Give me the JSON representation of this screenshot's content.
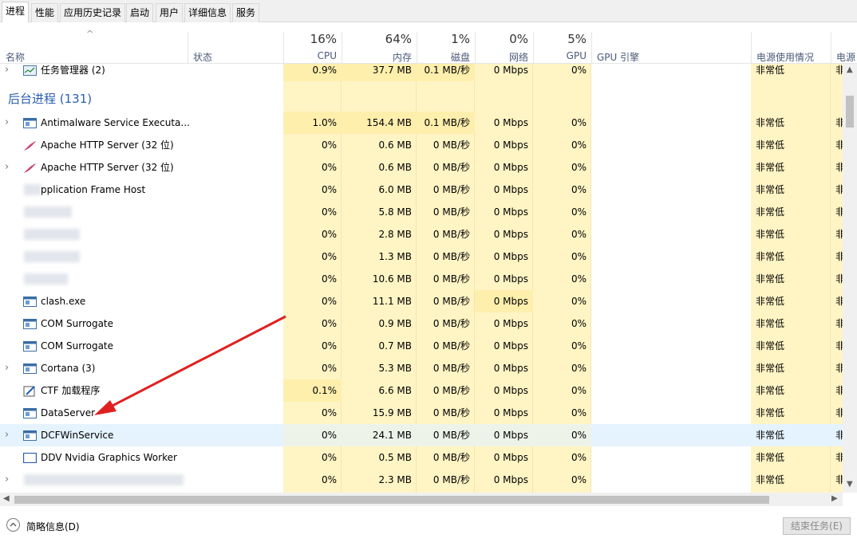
{
  "tabs": [
    "进程",
    "性能",
    "应用历史记录",
    "启动",
    "用户",
    "详细信息",
    "服务"
  ],
  "header": {
    "name_label": "名称",
    "status_label": "状态",
    "cpu": {
      "pct": "16%",
      "label": "CPU"
    },
    "mem": {
      "pct": "64%",
      "label": "内存"
    },
    "disk": {
      "pct": "1%",
      "label": "磁盘"
    },
    "net": {
      "pct": "0%",
      "label": "网络"
    },
    "gpu": {
      "pct": "5%",
      "label": "GPU"
    },
    "gpu_engine_label": "GPU 引擎",
    "power_label": "电源使用情况",
    "power_trend_label": "电源"
  },
  "top_row": {
    "name": "任务管理器 (2)",
    "cpu": "0.9%",
    "mem": "37.7 MB",
    "disk": "0.1 MB/秒",
    "net": "0 Mbps",
    "gpu": "0%",
    "power": "非常低",
    "power2": "非"
  },
  "group": {
    "title": "后台进程 (131)"
  },
  "rows": [
    {
      "name": "Antimalware Service Executa...",
      "cpu": "1.0%",
      "mem": "154.4 MB",
      "disk": "0.1 MB/秒",
      "net": "0 Mbps",
      "gpu": "0%",
      "power": "非常低",
      "power2": "非"
    },
    {
      "name": "Apache HTTP Server (32 位)",
      "cpu": "0%",
      "mem": "0.6 MB",
      "disk": "0 MB/秒",
      "net": "0 Mbps",
      "gpu": "0%",
      "power": "非常低",
      "power2": "非"
    },
    {
      "name": "Apache HTTP Server (32 位)",
      "cpu": "0%",
      "mem": "0.6 MB",
      "disk": "0 MB/秒",
      "net": "0 Mbps",
      "gpu": "0%",
      "power": "非常低",
      "power2": "非"
    },
    {
      "name": "pplication Frame Host",
      "cpu": "0%",
      "mem": "6.0 MB",
      "disk": "0 MB/秒",
      "net": "0 Mbps",
      "gpu": "0%",
      "power": "非常低",
      "power2": "非"
    },
    {
      "name": "",
      "cpu": "0%",
      "mem": "5.8 MB",
      "disk": "0 MB/秒",
      "net": "0 Mbps",
      "gpu": "0%",
      "power": "非常低",
      "power2": "非"
    },
    {
      "name": "",
      "cpu": "0%",
      "mem": "2.8 MB",
      "disk": "0 MB/秒",
      "net": "0 Mbps",
      "gpu": "0%",
      "power": "非常低",
      "power2": "非"
    },
    {
      "name": "",
      "cpu": "0%",
      "mem": "1.3 MB",
      "disk": "0 MB/秒",
      "net": "0 Mbps",
      "gpu": "0%",
      "power": "非常低",
      "power2": "非"
    },
    {
      "name": "",
      "cpu": "0%",
      "mem": "10.6 MB",
      "disk": "0 MB/秒",
      "net": "0 Mbps",
      "gpu": "0%",
      "power": "非常低",
      "power2": "非"
    },
    {
      "name": "clash.exe",
      "cpu": "0%",
      "mem": "11.1 MB",
      "disk": "0 MB/秒",
      "net": "0 Mbps",
      "gpu": "0%",
      "power": "非常低",
      "power2": "非"
    },
    {
      "name": "COM Surrogate",
      "cpu": "0%",
      "mem": "0.9 MB",
      "disk": "0 MB/秒",
      "net": "0 Mbps",
      "gpu": "0%",
      "power": "非常低",
      "power2": "非"
    },
    {
      "name": "COM Surrogate",
      "cpu": "0%",
      "mem": "0.7 MB",
      "disk": "0 MB/秒",
      "net": "0 Mbps",
      "gpu": "0%",
      "power": "非常低",
      "power2": "非"
    },
    {
      "name": "Cortana (3)",
      "cpu": "0%",
      "mem": "5.3 MB",
      "disk": "0 MB/秒",
      "net": "0 Mbps",
      "gpu": "0%",
      "power": "非常低",
      "power2": "非"
    },
    {
      "name": "CTF 加载程序",
      "cpu": "0.1%",
      "mem": "6.6 MB",
      "disk": "0 MB/秒",
      "net": "0 Mbps",
      "gpu": "0%",
      "power": "非常低",
      "power2": "非"
    },
    {
      "name": "DataServer",
      "cpu": "0%",
      "mem": "15.9 MB",
      "disk": "0 MB/秒",
      "net": "0 Mbps",
      "gpu": "0%",
      "power": "非常低",
      "power2": "非"
    },
    {
      "name": "DCFWinService",
      "cpu": "0%",
      "mem": "24.1 MB",
      "disk": "0 MB/秒",
      "net": "0 Mbps",
      "gpu": "0%",
      "power": "非常低",
      "power2": "非"
    },
    {
      "name": "DDV Nvidia Graphics Worker",
      "cpu": "0%",
      "mem": "0.5 MB",
      "disk": "0 MB/秒",
      "net": "0 Mbps",
      "gpu": "0%",
      "power": "非常低",
      "power2": "非"
    },
    {
      "name": "",
      "cpu": "0%",
      "mem": "2.3 MB",
      "disk": "0 MB/秒",
      "net": "0 Mbps",
      "gpu": "0%",
      "power": "非常低",
      "power2": "非"
    }
  ],
  "footer": {
    "collapse_label": "简略信息(D)",
    "end_task_label": "结束任务(E)"
  },
  "colors": {
    "heat": "#fff4c4",
    "heat_med": "#ffefad",
    "selected_row": "#e5f3ff",
    "group_title": "#2a5fb0",
    "arrow": "#e02020"
  }
}
